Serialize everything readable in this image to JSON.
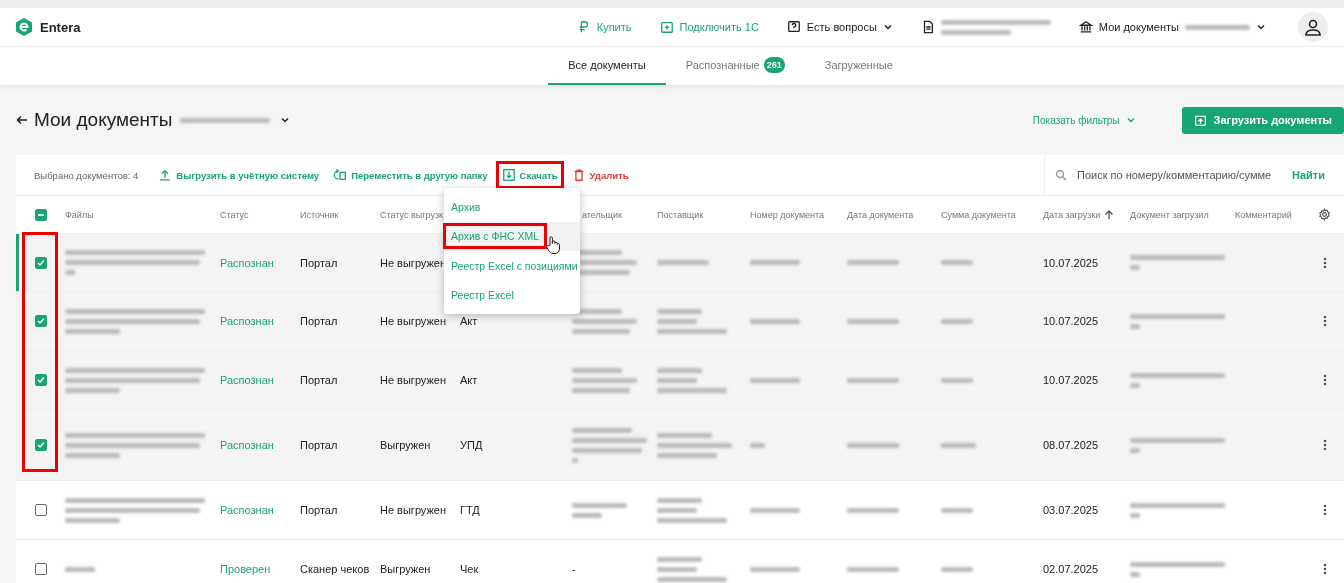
{
  "header": {
    "logo": "Entera",
    "nav": [
      {
        "kind": "buy",
        "label": "Купить"
      },
      {
        "kind": "connect",
        "label": "Подключить 1С"
      },
      {
        "kind": "help",
        "label": "Есть вопросы",
        "dropdown": true
      },
      {
        "kind": "company"
      },
      {
        "kind": "account",
        "label": "Мои документы",
        "dropdown": true
      }
    ]
  },
  "tabs": [
    {
      "label": "Все документы",
      "selected": true
    },
    {
      "label": "Распознанные",
      "selected": false,
      "count": "261"
    },
    {
      "label": "Загруженные",
      "selected": false
    }
  ],
  "page": {
    "title": "Мои документы",
    "filters_toggle": "Показать фильтры",
    "upload_button": "Загрузить документы"
  },
  "toolbar": {
    "selection_count": "Выбрано документов: 4",
    "actions": [
      {
        "kind": "export",
        "label": "Выгрузить в учётную систему",
        "highlighted": false
      },
      {
        "kind": "move",
        "label": "Переместить в другую папку",
        "highlighted": false
      },
      {
        "kind": "download",
        "label": "Скачать",
        "highlighted": true
      },
      {
        "kind": "delete",
        "label": "Удалить",
        "highlighted": false
      }
    ],
    "search": {
      "placeholder": "Поиск по номеру/комментарию/сумме",
      "button": "Найти"
    }
  },
  "download_menu": {
    "items": [
      {
        "label": "Архив",
        "hovered": false,
        "highlighted": false
      },
      {
        "label": "Архив с ФНС XML",
        "hovered": true,
        "highlighted": true
      },
      {
        "label": "Реестр Excel с позициями",
        "hovered": false,
        "highlighted": false
      },
      {
        "label": "Реестр Excel",
        "hovered": false,
        "highlighted": false
      }
    ]
  },
  "table": {
    "select_all_indeterminate": true,
    "checkbox_column_highlighted": true,
    "columns": {
      "files": {
        "label": "Файлы"
      },
      "status": {
        "label": "Статус"
      },
      "source": {
        "label": "Источник"
      },
      "export_status": {
        "label": "Статус выгрузк"
      },
      "payer": {
        "label": "ательщик"
      },
      "supplier": {
        "label": "Поставщик"
      },
      "number": {
        "label": "Номер документа"
      },
      "doc_date": {
        "label": "Дата документа"
      },
      "sum": {
        "label": "Сумма документа"
      },
      "upload_date": {
        "label": "Дата загрузки",
        "sort_ascending": true
      },
      "uploaded_by": {
        "label": "Документ загрузил"
      },
      "comment": {
        "label": "Комментарий"
      }
    },
    "rows": [
      {
        "checked": true,
        "current": true,
        "status": "Распознан",
        "source": "Портал",
        "export_status": "Не выгружен",
        "upload_date": "10.07.2025"
      },
      {
        "checked": true,
        "current": false,
        "status": "Распознан",
        "source": "Портал",
        "export_status": "Не выгружен",
        "doc_type": "Акт",
        "upload_date": "10.07.2025"
      },
      {
        "checked": true,
        "current": false,
        "status": "Распознан",
        "source": "Портал",
        "export_status": "Не выгружен",
        "doc_type": "Акт",
        "upload_date": "10.07.2025"
      },
      {
        "checked": true,
        "current": false,
        "status": "Распознан",
        "source": "Портал",
        "export_status": "Выгружен",
        "doc_type": "УПД",
        "upload_date": "08.07.2025"
      },
      {
        "checked": false,
        "current": false,
        "status": "Распознан",
        "source": "Портал",
        "export_status": "Не выгружен",
        "doc_type": "ГТД",
        "upload_date": "03.07.2025"
      },
      {
        "checked": false,
        "current": false,
        "status": "Проверен",
        "source": "Сканер чеков",
        "export_status": "Выгружен",
        "doc_type": "Чек",
        "payer": "-",
        "upload_date": "02.07.2025"
      }
    ]
  }
}
